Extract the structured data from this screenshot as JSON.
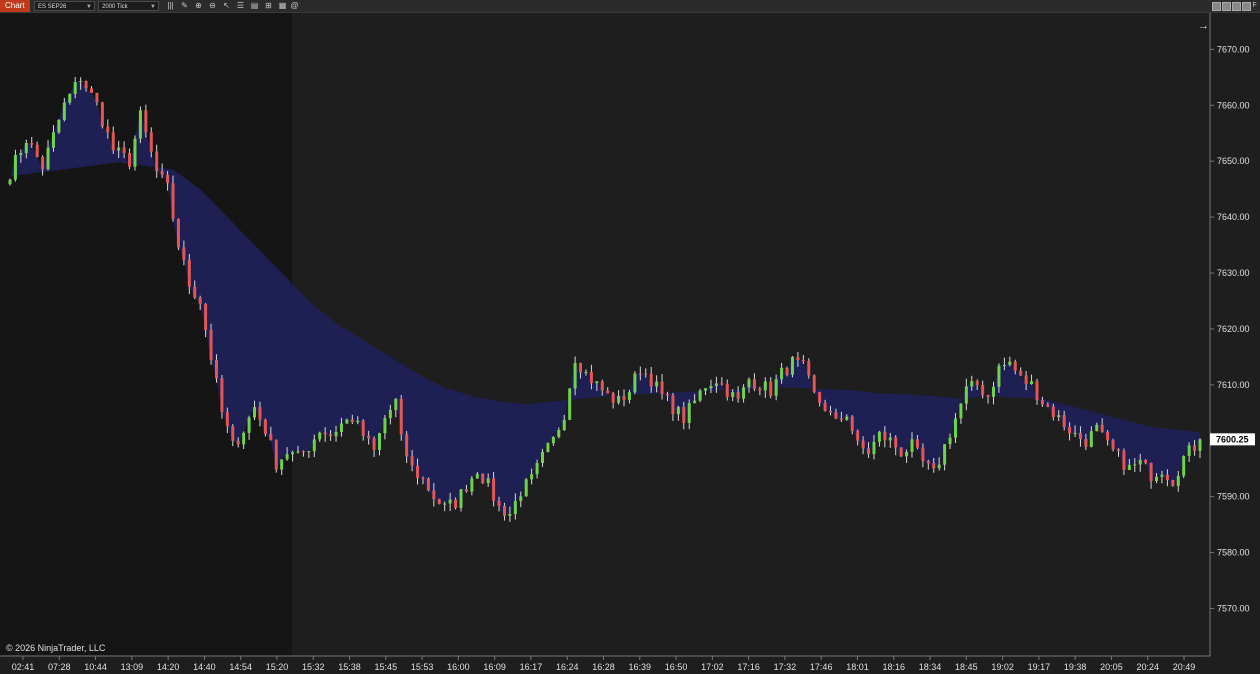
{
  "toolbar": {
    "chart_tab": "Chart",
    "instrument": "ES SEP26",
    "bar_type": "2000 Tick",
    "f_label": "F",
    "icons": [
      "bars-icon",
      "pencil-icon",
      "zoom-in-icon",
      "zoom-out-icon",
      "cursor-icon",
      "properties-icon",
      "strategies-icon",
      "indicators-icon",
      "templates-icon"
    ]
  },
  "colors": {
    "background": "#1e1e1e",
    "session_shade": "#151515",
    "up_bar": "#6fd24f",
    "down_bar": "#e45656",
    "wick": "#d8d8d8",
    "cloud_fill": "#1f2056",
    "price_badge": "#ffffff"
  },
  "footer": {
    "copyright": "© 2026 NinjaTrader, LLC"
  },
  "chart_data": {
    "type": "candlestick",
    "title": "",
    "xlabel": "",
    "ylabel": "",
    "grid": false,
    "ylim": [
      7561.5,
      7676.5
    ],
    "yticks": [
      "7670.00",
      "7660.00",
      "7650.00",
      "7640.00",
      "7630.00",
      "7620.00",
      "7610.00",
      "7600.00",
      "7590.00",
      "7580.00",
      "7570.00"
    ],
    "last_price": "7600.25",
    "x_labels": [
      "02:41",
      "07:28",
      "10:44",
      "13:09",
      "14:20",
      "14:40",
      "14:54",
      "15:20",
      "15:32",
      "15:38",
      "15:45",
      "15:53",
      "16:00",
      "16:09",
      "16:17",
      "16:24",
      "16:28",
      "16:39",
      "16:50",
      "17:02",
      "17:16",
      "17:32",
      "17:46",
      "18:01",
      "18:16",
      "18:34",
      "18:45",
      "19:02",
      "19:17",
      "19:38",
      "20:05",
      "20:24",
      "20:49"
    ],
    "close_path": [
      [
        0,
        7648
      ],
      [
        3,
        7654
      ],
      [
        6,
        7649
      ],
      [
        10,
        7660
      ],
      [
        13,
        7665
      ],
      [
        16,
        7660
      ],
      [
        19,
        7652
      ],
      [
        22,
        7650
      ],
      [
        24,
        7658
      ],
      [
        27,
        7648
      ],
      [
        29,
        7645
      ],
      [
        31,
        7635
      ],
      [
        33,
        7628
      ],
      [
        35,
        7625
      ],
      [
        37,
        7615
      ],
      [
        39,
        7605
      ],
      [
        41,
        7599
      ],
      [
        43,
        7602
      ],
      [
        45,
        7606
      ],
      [
        47,
        7602
      ],
      [
        49,
        7596
      ],
      [
        51,
        7598
      ],
      [
        53,
        7597
      ],
      [
        55,
        7599
      ],
      [
        57,
        7602
      ],
      [
        59,
        7601
      ],
      [
        61,
        7603
      ],
      [
        63,
        7604
      ],
      [
        65,
        7601
      ],
      [
        67,
        7598
      ],
      [
        69,
        7604
      ],
      [
        71,
        7607
      ],
      [
        72,
        7600
      ],
      [
        74,
        7595
      ],
      [
        76,
        7593
      ],
      [
        78,
        7590
      ],
      [
        80,
        7588
      ],
      [
        82,
        7589
      ],
      [
        84,
        7592
      ],
      [
        86,
        7595
      ],
      [
        88,
        7592
      ],
      [
        90,
        7588
      ],
      [
        92,
        7587
      ],
      [
        94,
        7591
      ],
      [
        96,
        7593
      ],
      [
        98,
        7597
      ],
      [
        100,
        7600
      ],
      [
        102,
        7605
      ],
      [
        104,
        7615
      ],
      [
        106,
        7612
      ],
      [
        108,
        7610
      ],
      [
        110,
        7608
      ],
      [
        112,
        7607
      ],
      [
        114,
        7609
      ],
      [
        116,
        7613
      ],
      [
        118,
        7611
      ],
      [
        120,
        7608
      ],
      [
        122,
        7606
      ],
      [
        124,
        7604
      ],
      [
        126,
        7607
      ],
      [
        128,
        7610
      ],
      [
        130,
        7611
      ],
      [
        132,
        7609
      ],
      [
        134,
        7607
      ],
      [
        136,
        7611
      ],
      [
        138,
        7610
      ],
      [
        140,
        7609
      ],
      [
        142,
        7612
      ],
      [
        144,
        7614
      ],
      [
        146,
        7613
      ],
      [
        148,
        7608
      ],
      [
        150,
        7606
      ],
      [
        152,
        7603
      ],
      [
        154,
        7605
      ],
      [
        156,
        7599
      ],
      [
        158,
        7598
      ],
      [
        160,
        7601
      ],
      [
        162,
        7600
      ],
      [
        164,
        7598
      ],
      [
        166,
        7599
      ],
      [
        168,
        7596
      ],
      [
        170,
        7594
      ],
      [
        172,
        7599
      ],
      [
        174,
        7604
      ],
      [
        176,
        7609
      ],
      [
        178,
        7610
      ],
      [
        180,
        7608
      ],
      [
        182,
        7613
      ],
      [
        184,
        7614
      ],
      [
        186,
        7611
      ],
      [
        188,
        7610
      ],
      [
        190,
        7607
      ],
      [
        192,
        7605
      ],
      [
        194,
        7603
      ],
      [
        196,
        7601
      ],
      [
        198,
        7600
      ],
      [
        200,
        7602
      ],
      [
        202,
        7599
      ],
      [
        204,
        7597
      ],
      [
        206,
        7595
      ],
      [
        208,
        7596
      ],
      [
        210,
        7594
      ],
      [
        212,
        7595
      ],
      [
        214,
        7593
      ],
      [
        216,
        7597
      ],
      [
        218,
        7599
      ],
      [
        219,
        7600.25
      ]
    ],
    "cloud_average": [
      [
        0,
        7647.3
      ],
      [
        20,
        7649.8
      ],
      [
        30,
        7648.5
      ],
      [
        35,
        7645
      ],
      [
        40,
        7640
      ],
      [
        45,
        7635
      ],
      [
        50,
        7630
      ],
      [
        55,
        7625
      ],
      [
        60,
        7621
      ],
      [
        65,
        7618
      ],
      [
        70,
        7615
      ],
      [
        75,
        7612
      ],
      [
        80,
        7609.5
      ],
      [
        85,
        7608
      ],
      [
        90,
        7607
      ],
      [
        95,
        7606.5
      ],
      [
        100,
        7607
      ],
      [
        105,
        7607.5
      ],
      [
        110,
        7608
      ],
      [
        120,
        7608.5
      ],
      [
        130,
        7609
      ],
      [
        140,
        7609.5
      ],
      [
        145,
        7609.5
      ],
      [
        150,
        7609.2
      ],
      [
        155,
        7609
      ],
      [
        160,
        7608.5
      ],
      [
        170,
        7608
      ],
      [
        175,
        7607.5
      ],
      [
        180,
        7608
      ],
      [
        190,
        7607.5
      ],
      [
        200,
        7605
      ],
      [
        210,
        7602.5
      ],
      [
        219,
        7601.5
      ]
    ]
  }
}
